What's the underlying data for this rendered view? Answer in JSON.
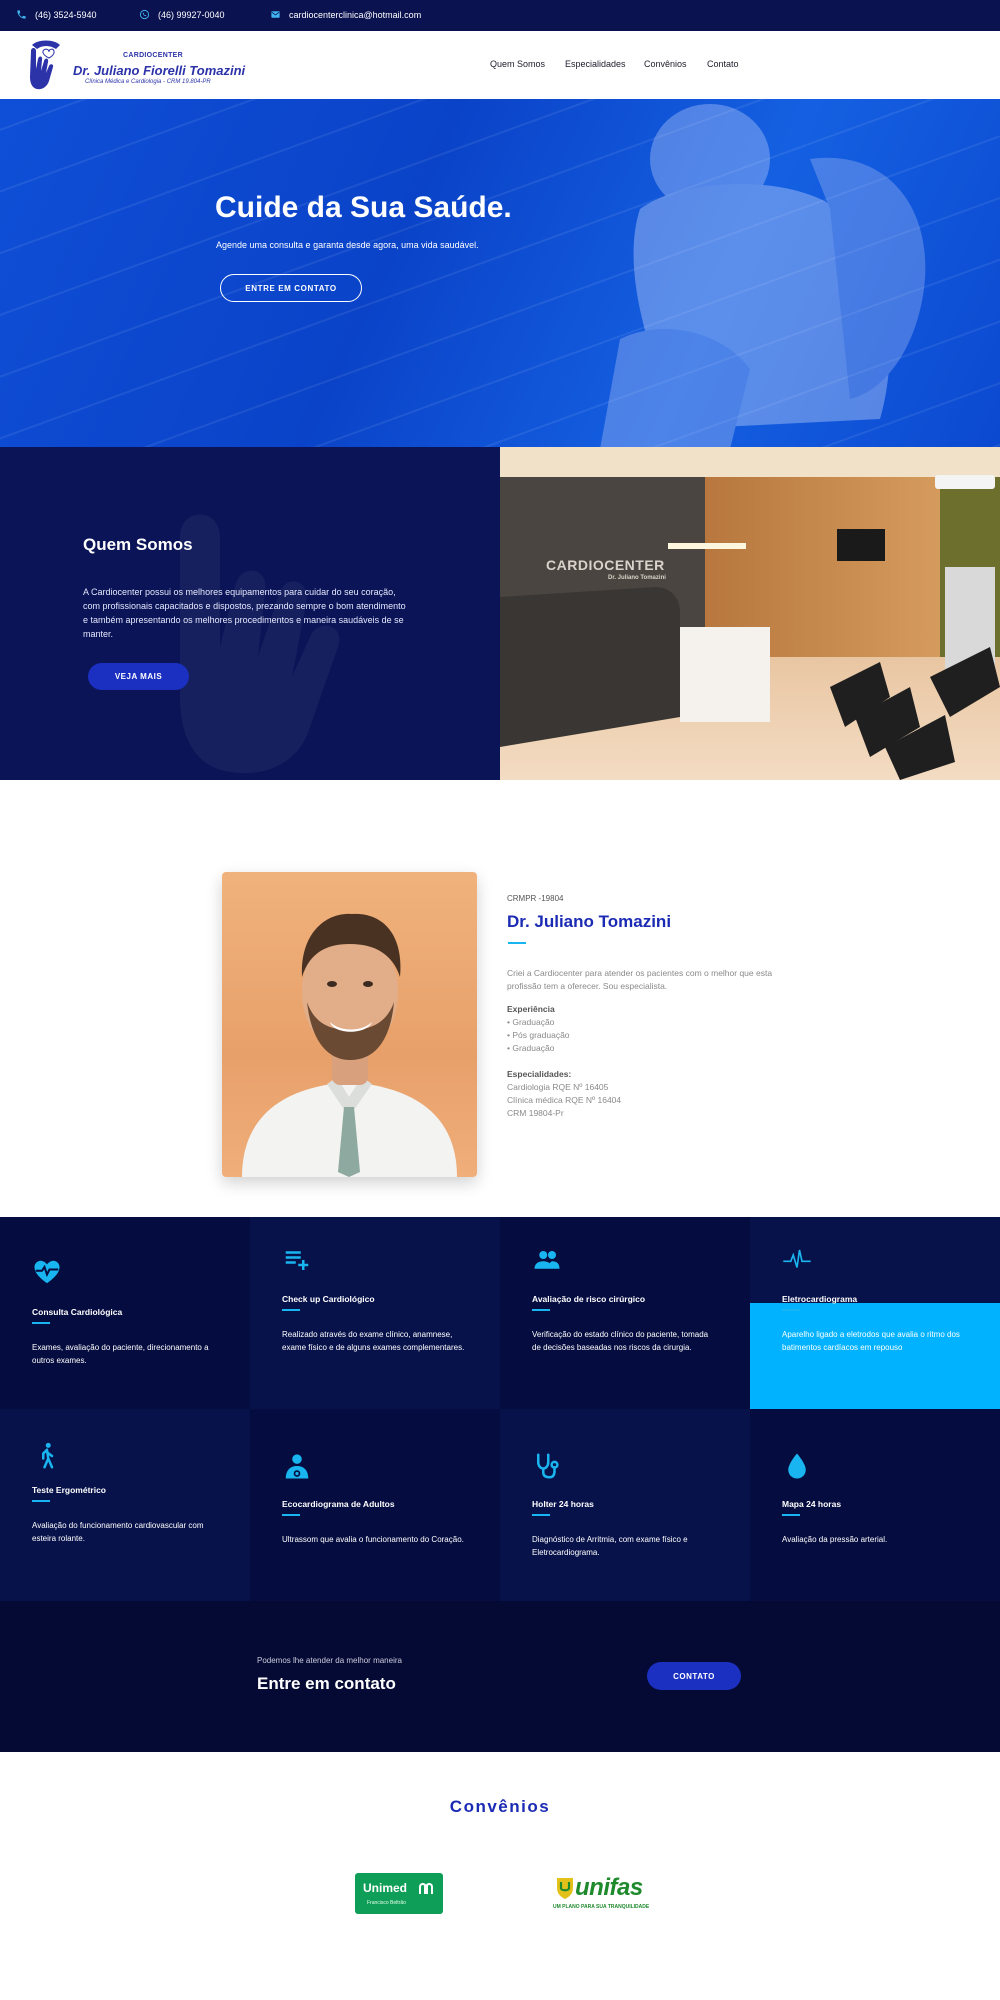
{
  "topbar": {
    "phone1": "(46) 3524-5940",
    "phone2": "(46) 99927-0040",
    "email": "cardiocenterclinica@hotmail.com"
  },
  "logo": {
    "line1": "CARDIOCENTER",
    "line2": "Dr. Juliano Fiorelli Tomazini",
    "line3": "Clínica Médica e Cardiologia - CRM 19.804-PR"
  },
  "nav": [
    "Quem Somos",
    "Especialidades",
    "Convênios",
    "Contato"
  ],
  "hero": {
    "title": "Cuide da Sua Saúde.",
    "subtitle": "Agende uma consulta e garanta desde agora, uma vida saudável.",
    "button": "ENTRE EM CONTATO"
  },
  "about": {
    "title": "Quem Somos",
    "text": "A Cardiocenter possui os melhores equipamentos para cuidar do seu coração, com profissionais capacitados e dispostos, prezando sempre o bom atendimento e também apresentando os melhores procedimentos e maneira saudáveis de se manter.",
    "button": "VEJA MAIS"
  },
  "clinic": {
    "sign": "CARDIOCENTER",
    "sign_sub": "Dr. Juliano Tomazini"
  },
  "doctor": {
    "crm": "CRMPR -19804",
    "name": "Dr. Juliano Tomazini",
    "intro": "Criei a Cardiocenter para atender os pacientes com o melhor que esta profissão tem a oferecer. Sou especialista.",
    "exp_title": "Experiência",
    "exp": [
      "• Graduação",
      "• Pós graduação",
      "• Graduação"
    ],
    "spec_title": "Especialidades:",
    "spec": [
      "Cardiologia RQE Nº 16405",
      "Clínica médica RQE Nº 16404",
      "CRM 19804-Pr"
    ]
  },
  "services": [
    {
      "icon": "heart-pulse-icon",
      "title": "Consulta Cardiológica",
      "desc": "Exames, avaliação do paciente, direcionamento a outros exames."
    },
    {
      "icon": "playlist-add-icon",
      "title": "Check up Cardiológico",
      "desc": "Realizado através do exame clínico, anamnese, exame físico e de alguns exames complementares."
    },
    {
      "icon": "people-icon",
      "title": "Avaliação de risco cirúrgico",
      "desc": "Verificação do estado clínico do paciente, tomada de decisões baseadas nos riscos da cirurgia."
    },
    {
      "icon": "ecg-line-icon",
      "title": "Eletrocardiograma",
      "desc": "Aparelho ligado a eletrodos que avalia o ritmo dos batimentos cardíacos em repouso"
    },
    {
      "icon": "walking-person-icon",
      "title": "Teste Ergométrico",
      "desc": "Avaliação do funcionamento cardiovascular com esteira rolante."
    },
    {
      "icon": "doctor-icon",
      "title": "Ecocardiograma de Adultos",
      "desc": "Ultrassom que avalia o funcionamento do Coração."
    },
    {
      "icon": "stethoscope-icon",
      "title": "Holter 24 horas",
      "desc": "Diagnóstico de Arritmia, com exame físico e Eletrocardiograma."
    },
    {
      "icon": "blood-drop-icon",
      "title": "Mapa 24 horas",
      "desc": "Avaliação da pressão arterial."
    }
  ],
  "contact": {
    "subtitle": "Podemos lhe atender da melhor maneira",
    "title": "Entre em contato",
    "button": "CONTATO"
  },
  "convenios": {
    "title": "Convênios",
    "unimed": "Unimed",
    "unimed_sub": "Francisco Beltrão",
    "unifas": "unifas",
    "unifas_sub": "UM PLANO PARA SUA TRANQUILIDADE"
  },
  "colors": {
    "navy": "#0b1250",
    "brand_blue": "#1c2bb4",
    "accent_cyan": "#19b5f0",
    "hero_blue": "#0a43c8"
  }
}
